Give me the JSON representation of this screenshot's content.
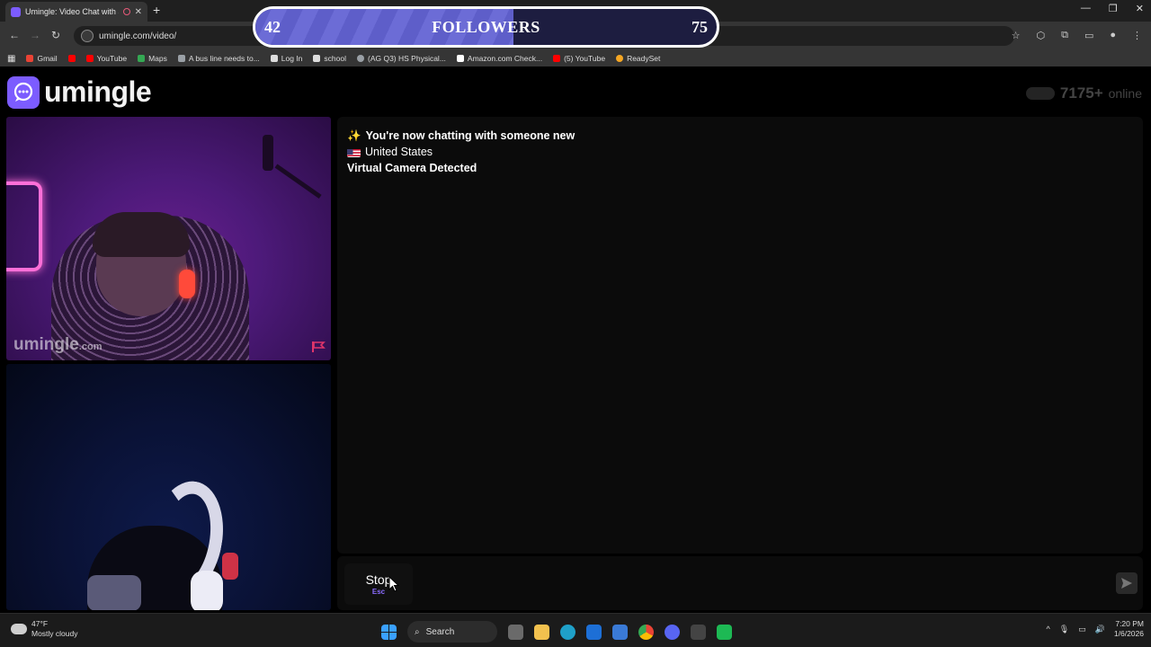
{
  "browser": {
    "tab_title": "Umingle: Video Chat with S",
    "url": "umingle.com/video/",
    "bookmarks": [
      {
        "label": "Gmail",
        "icon": "gmail-icon",
        "color": "#ea4335"
      },
      {
        "label": "",
        "icon": "youtube-icon",
        "color": "#ff0000"
      },
      {
        "label": "YouTube",
        "icon": "youtube-icon",
        "color": "#ff0000"
      },
      {
        "label": "Maps",
        "icon": "maps-icon",
        "color": "#34a853"
      },
      {
        "label": "A bus line needs to...",
        "icon": "doc-icon",
        "color": "#9aa0a6"
      },
      {
        "label": "Log In",
        "icon": "school-icon",
        "color": "#dddddd"
      },
      {
        "label": "school",
        "icon": "school-icon",
        "color": "#dddddd"
      },
      {
        "label": "(AG Q3) HS Physical...",
        "icon": "globe-icon",
        "color": "#9aa0a6"
      },
      {
        "label": "Amazon.com Check...",
        "icon": "amazon-icon",
        "color": "#ffffff"
      },
      {
        "label": "(5) YouTube",
        "icon": "youtube-icon",
        "color": "#ff0000"
      },
      {
        "label": "ReadySet",
        "icon": "readyset-icon",
        "color": "#f5a623"
      }
    ]
  },
  "followers": {
    "current": "42",
    "label": "FOLLOWERS",
    "goal": "75",
    "progress": 0.56
  },
  "app": {
    "logo_text": "umingle",
    "online_count": "7175+",
    "online_label": "online",
    "accent_color": "#7c5cff"
  },
  "video": {
    "watermark": "umingle",
    "watermark_suffix": ".com"
  },
  "chat": {
    "messages": [
      {
        "icon": "sparkles-icon",
        "text": "You're now chatting with someone new",
        "bold": true
      },
      {
        "icon": "us-flag-icon",
        "text": "United States",
        "bold": false
      },
      {
        "icon": "",
        "text": "Virtual Camera Detected",
        "bold": true
      }
    ],
    "stop_label": "Stop",
    "stop_shortcut": "Esc",
    "input_value": ""
  },
  "taskbar": {
    "temperature": "47°F",
    "condition": "Mostly cloudy",
    "search_label": "Search",
    "time": "7:20 PM",
    "date": "1/6/2026"
  }
}
